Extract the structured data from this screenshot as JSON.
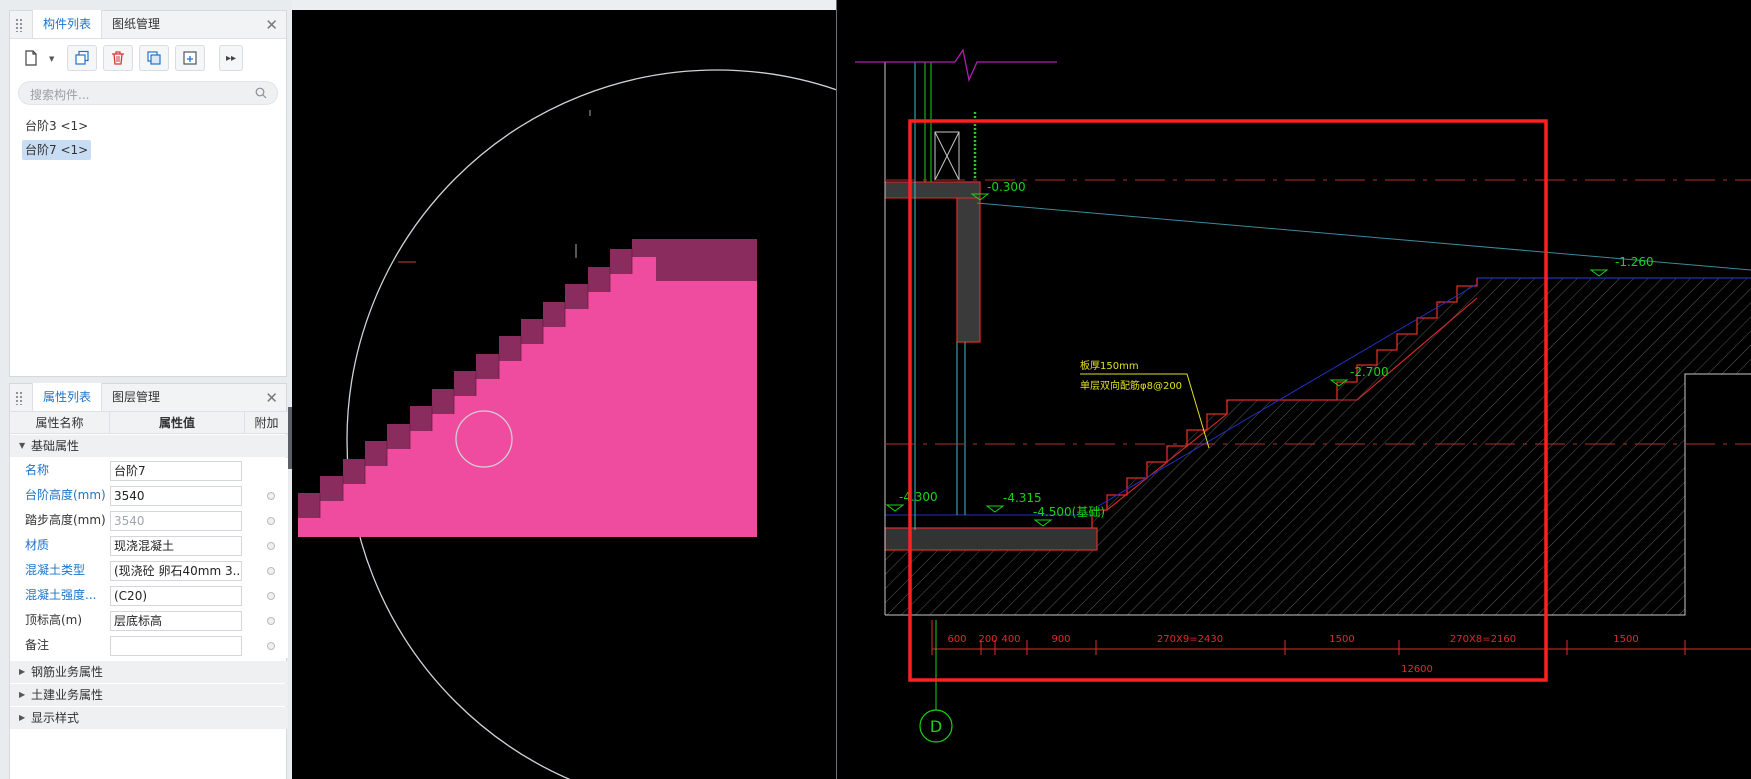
{
  "component_panel": {
    "tab_active": "构件列表",
    "tab_inactive": "图纸管理",
    "search_placeholder": "搜索构件...",
    "items": [
      {
        "label": "台阶3 <1>",
        "selected": false
      },
      {
        "label": "台阶7 <1>",
        "selected": true
      }
    ]
  },
  "property_panel": {
    "tab_active": "属性列表",
    "tab_inactive": "图层管理",
    "col_name": "属性名称",
    "col_value": "属性值",
    "col_extra": "附加",
    "group_basic": "基础属性",
    "rows": [
      {
        "name": "名称",
        "value": "台阶7",
        "blue": true,
        "has_dot": false,
        "grey": false
      },
      {
        "name": "台阶高度(mm)",
        "value": "3540",
        "blue": true,
        "has_dot": true,
        "grey": false
      },
      {
        "name": "踏步高度(mm)",
        "value": "3540",
        "blue": false,
        "has_dot": true,
        "grey": true
      },
      {
        "name": "材质",
        "value": "现浇混凝土",
        "blue": true,
        "has_dot": true,
        "grey": false
      },
      {
        "name": "混凝土类型",
        "value": "(现浇砼 卵石40mm 3...",
        "blue": true,
        "has_dot": true,
        "grey": false
      },
      {
        "name": "混凝土强度...",
        "value": "(C20)",
        "blue": true,
        "has_dot": true,
        "grey": false
      },
      {
        "name": "顶标高(m)",
        "value": "层底标高",
        "blue": false,
        "has_dot": true,
        "grey": false
      },
      {
        "name": "备注",
        "value": "",
        "blue": false,
        "has_dot": true,
        "grey": false
      }
    ],
    "groups_collapsed": [
      "钢筋业务属性",
      "土建业务属性",
      "显示样式"
    ]
  },
  "cad": {
    "elev_labels": [
      "-0.300",
      "-1.260",
      "-2.700",
      "-4.300",
      "-4.315",
      "-4.500(基础)"
    ],
    "note_line1": "板厚150mm",
    "note_line2": "单层双向配筋φ8@200",
    "dims": [
      "600",
      "200",
      "400",
      "900",
      "270X9=2430",
      "1500",
      "270X8=2160",
      "1500"
    ],
    "total_dim": "12600",
    "axis_label": "D"
  },
  "colors": {
    "accent": "#1e73c8",
    "stair_top": "#8a2c5e",
    "stair_body": "#f04c9f",
    "cad_green": "#19d219",
    "cad_red": "#e12b2b",
    "highlight_box": "#ff2020"
  }
}
